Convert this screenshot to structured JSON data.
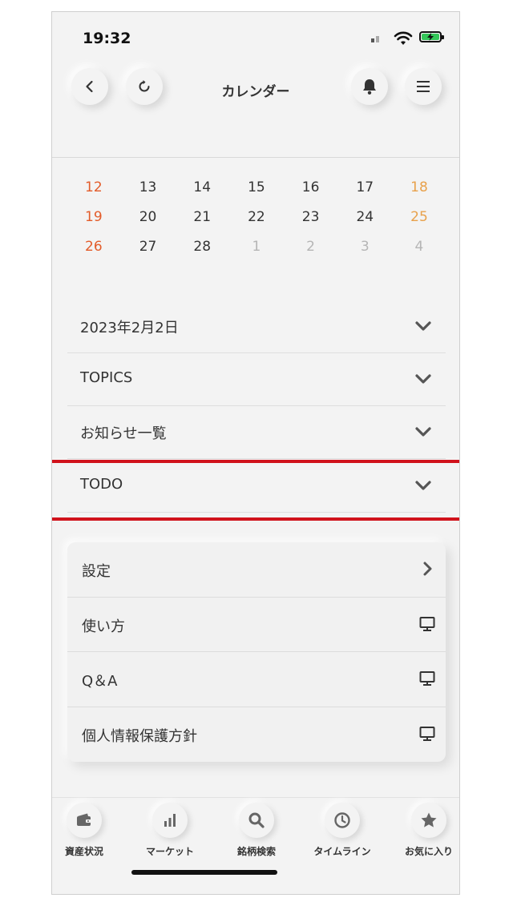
{
  "status": {
    "time": "19:32"
  },
  "header": {
    "title": "カレンダー"
  },
  "calendar": {
    "weeks": [
      [
        "12",
        "13",
        "14",
        "15",
        "16",
        "17",
        "18"
      ],
      [
        "19",
        "20",
        "21",
        "22",
        "23",
        "24",
        "25"
      ],
      [
        "26",
        "27",
        "28",
        "1",
        "2",
        "3",
        "4"
      ]
    ]
  },
  "accordion": [
    {
      "label": "2023年2月2日"
    },
    {
      "label": "TOPICS"
    },
    {
      "label": "お知らせ一覧"
    },
    {
      "label": "TODO"
    }
  ],
  "menu": [
    {
      "label": "設定",
      "icon": "chevron-right-icon"
    },
    {
      "label": "使い方",
      "icon": "monitor-icon"
    },
    {
      "label": "Q＆A",
      "icon": "monitor-icon"
    },
    {
      "label": "個人情報保護方針",
      "icon": "monitor-icon"
    }
  ],
  "tabs": [
    {
      "label": "資産状況",
      "icon": "wallet-icon"
    },
    {
      "label": "マーケット",
      "icon": "bar-chart-icon"
    },
    {
      "label": "銘柄検索",
      "icon": "search-icon"
    },
    {
      "label": "タイムライン",
      "icon": "clock-icon"
    },
    {
      "label": "お気に入り",
      "icon": "star-icon"
    }
  ],
  "colors": {
    "sunday": "#e35c2a",
    "saturday": "#e8a14b",
    "highlight": "#d0121b",
    "battery": "#34c759"
  }
}
